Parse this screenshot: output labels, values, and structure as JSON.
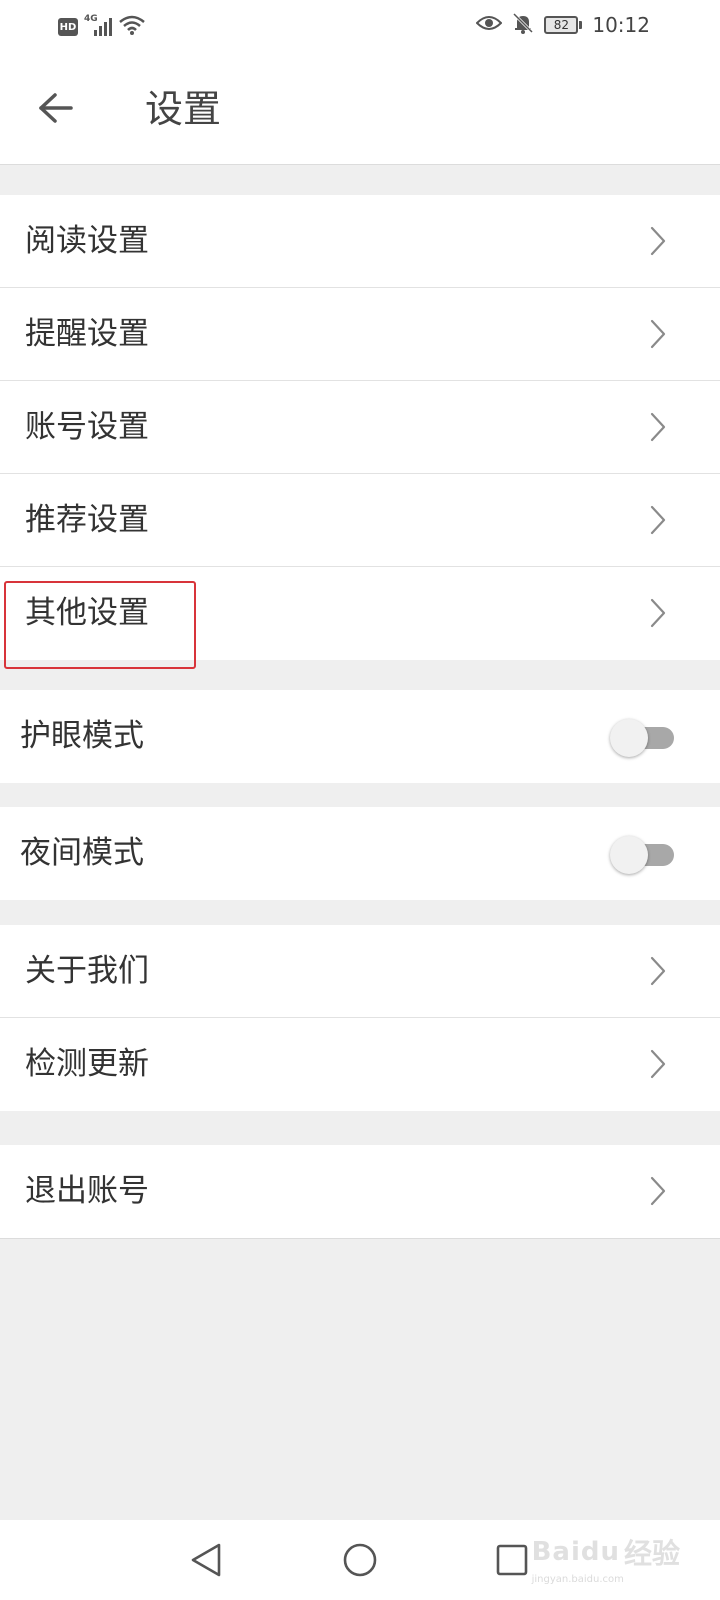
{
  "status_bar": {
    "hd": "HD",
    "network": "4G",
    "battery": "82",
    "time": "10:12"
  },
  "header": {
    "title": "设置"
  },
  "groups": {
    "settings": [
      {
        "label": "阅读设置"
      },
      {
        "label": "提醒设置"
      },
      {
        "label": "账号设置"
      },
      {
        "label": "推荐设置"
      },
      {
        "label": "其他设置"
      }
    ],
    "eye_mode": {
      "label": "护眼模式",
      "enabled": false
    },
    "night_mode": {
      "label": "夜间模式",
      "enabled": false
    },
    "about": [
      {
        "label": "关于我们"
      },
      {
        "label": "检测更新"
      }
    ],
    "logout": {
      "label": "退出账号"
    }
  },
  "watermark": {
    "brand": "Baidu",
    "suffix": "经验",
    "url": "jingyan.baidu.com"
  },
  "colors": {
    "highlight": "#d8343a",
    "background": "#efefef"
  }
}
